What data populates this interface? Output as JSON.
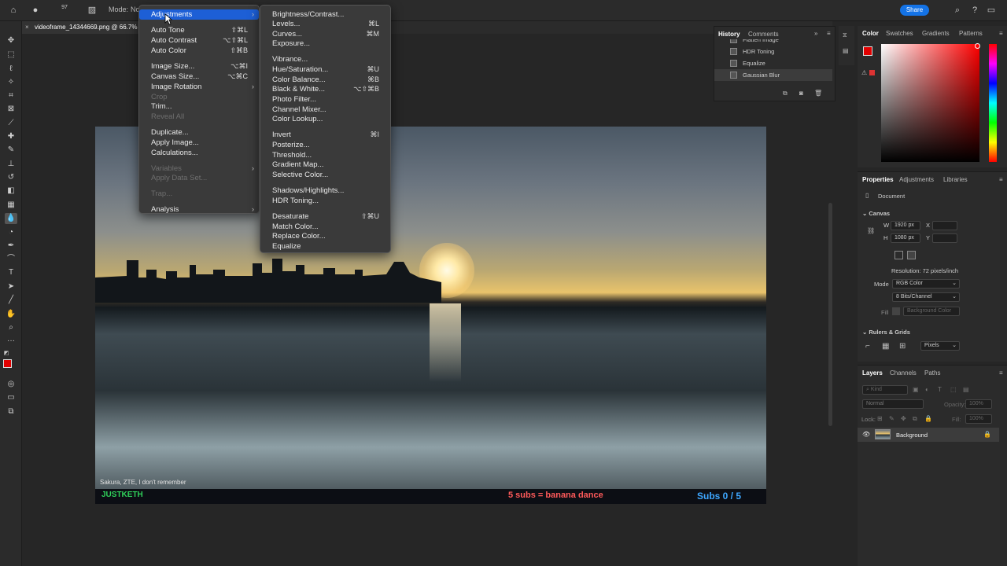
{
  "optionbar": {
    "mode_label": "Mode:",
    "mode_value": "No",
    "brush_size": "97",
    "share_label": "Share"
  },
  "document": {
    "tab_title": "videoframe_14344669.png @ 66.7%"
  },
  "image_overlay": {
    "caption": "Sakura, ZTE, I don't remember",
    "left_text": "JUSTKETH",
    "mid_text": "5 subs = banana dance",
    "right_text": "Subs 0 / 5"
  },
  "image_menu": {
    "items": [
      {
        "label": "Adjustments",
        "shortcut": "",
        "submenu": true,
        "state": "highlight"
      },
      {
        "label": "Auto Tone",
        "shortcut": "⇧⌘L"
      },
      {
        "label": "Auto Contrast",
        "shortcut": "⌥⇧⌘L"
      },
      {
        "label": "Auto Color",
        "shortcut": "⇧⌘B"
      },
      {
        "label": "Image Size...",
        "shortcut": "⌥⌘I"
      },
      {
        "label": "Canvas Size...",
        "shortcut": "⌥⌘C"
      },
      {
        "label": "Image Rotation",
        "shortcut": "",
        "submenu": true
      },
      {
        "label": "Crop",
        "shortcut": "",
        "state": "disabled"
      },
      {
        "label": "Trim...",
        "shortcut": ""
      },
      {
        "label": "Reveal All",
        "shortcut": "",
        "state": "disabled"
      },
      {
        "label": "Duplicate...",
        "shortcut": ""
      },
      {
        "label": "Apply Image...",
        "shortcut": ""
      },
      {
        "label": "Calculations...",
        "shortcut": ""
      },
      {
        "label": "Variables",
        "shortcut": "",
        "submenu": true,
        "state": "disabled"
      },
      {
        "label": "Apply Data Set...",
        "shortcut": "",
        "state": "disabled"
      },
      {
        "label": "Trap...",
        "shortcut": "",
        "state": "disabled"
      },
      {
        "label": "Analysis",
        "shortcut": "",
        "submenu": true
      }
    ]
  },
  "adjustments_menu": {
    "items": [
      {
        "label": "Brightness/Contrast...",
        "shortcut": ""
      },
      {
        "label": "Levels...",
        "shortcut": "⌘L"
      },
      {
        "label": "Curves...",
        "shortcut": "⌘M"
      },
      {
        "label": "Exposure...",
        "shortcut": ""
      },
      {
        "label": "Vibrance...",
        "shortcut": ""
      },
      {
        "label": "Hue/Saturation...",
        "shortcut": "⌘U"
      },
      {
        "label": "Color Balance...",
        "shortcut": "⌘B"
      },
      {
        "label": "Black & White...",
        "shortcut": "⌥⇧⌘B"
      },
      {
        "label": "Photo Filter...",
        "shortcut": ""
      },
      {
        "label": "Channel Mixer...",
        "shortcut": ""
      },
      {
        "label": "Color Lookup...",
        "shortcut": ""
      },
      {
        "label": "Invert",
        "shortcut": "⌘I"
      },
      {
        "label": "Posterize...",
        "shortcut": ""
      },
      {
        "label": "Threshold...",
        "shortcut": ""
      },
      {
        "label": "Gradient Map...",
        "shortcut": ""
      },
      {
        "label": "Selective Color...",
        "shortcut": ""
      },
      {
        "label": "Shadows/Highlights...",
        "shortcut": ""
      },
      {
        "label": "HDR Toning...",
        "shortcut": ""
      },
      {
        "label": "Desaturate",
        "shortcut": "⇧⌘U"
      },
      {
        "label": "Match Color...",
        "shortcut": ""
      },
      {
        "label": "Replace Color...",
        "shortcut": ""
      },
      {
        "label": "Equalize",
        "shortcut": ""
      }
    ]
  },
  "history_panel": {
    "tabs": [
      "History",
      "Comments"
    ],
    "items": [
      "Flatten Image",
      "HDR Toning",
      "Equalize",
      "Gaussian Blur"
    ]
  },
  "color_panel": {
    "tabs": [
      "Color",
      "Swatches",
      "Gradients",
      "Patterns"
    ],
    "foreground": "#e10000"
  },
  "properties_panel": {
    "tabs": [
      "Properties",
      "Adjustments",
      "Libraries"
    ],
    "doc_label": "Document",
    "canvas_heading": "Canvas",
    "w_label": "W",
    "w_value": "1920 px",
    "h_label": "H",
    "h_value": "1080 px",
    "x_label": "X",
    "y_label": "Y",
    "resolution": "Resolution: 72 pixels/inch",
    "mode_label": "Mode",
    "mode_value": "RGB Color",
    "depth_value": "8 Bits/Channel",
    "fill_label": "Fill",
    "fill_value": "Background Color",
    "rulers_heading": "Rulers & Grids",
    "units_value": "Pixels"
  },
  "layers_panel": {
    "tabs": [
      "Layers",
      "Channels",
      "Paths"
    ],
    "kind_placeholder": "Kind",
    "blend_mode": "Normal",
    "opacity_label": "Opacity:",
    "opacity_value": "100%",
    "lock_label": "Lock:",
    "fill_label": "Fill:",
    "fill_value": "100%",
    "layers": [
      {
        "name": "Background",
        "visible": true,
        "locked": true
      }
    ]
  }
}
